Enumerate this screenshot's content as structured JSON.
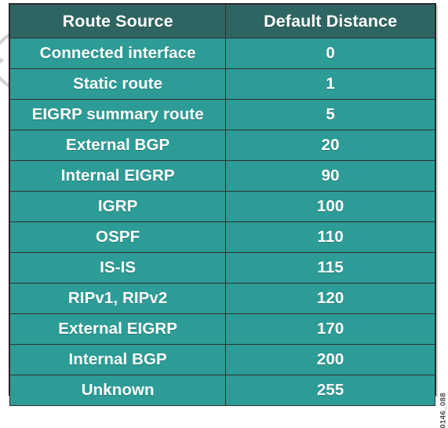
{
  "figure": {
    "id_watermark": "0146_088",
    "decorative_edge_icon": "chevron-artifact"
  },
  "colors": {
    "header_bg": "#2e6562",
    "cell_bg": "#2d9c96",
    "text": "#ffffff",
    "gridline": "#2f2f2f",
    "page_bg": "#ffffff",
    "watermark_text": "#4a4a4a"
  },
  "table": {
    "columns": [
      {
        "key": "route_source",
        "label": "Route Source"
      },
      {
        "key": "default_distance",
        "label": "Default Distance"
      }
    ],
    "rows": [
      {
        "route_source": "Connected interface",
        "default_distance": "0"
      },
      {
        "route_source": "Static route",
        "default_distance": "1"
      },
      {
        "route_source": "EIGRP summary route",
        "default_distance": "5"
      },
      {
        "route_source": "External BGP",
        "default_distance": "20"
      },
      {
        "route_source": "Internal EIGRP",
        "default_distance": "90"
      },
      {
        "route_source": "IGRP",
        "default_distance": "100"
      },
      {
        "route_source": "OSPF",
        "default_distance": "110"
      },
      {
        "route_source": "IS-IS",
        "default_distance": "115"
      },
      {
        "route_source": "RIPv1, RIPv2",
        "default_distance": "120"
      },
      {
        "route_source": "External EIGRP",
        "default_distance": "170"
      },
      {
        "route_source": "Internal BGP",
        "default_distance": "200"
      },
      {
        "route_source": "Unknown",
        "default_distance": "255"
      }
    ]
  },
  "chart_data": {
    "type": "table",
    "title": "",
    "columns": [
      "Route Source",
      "Default Distance"
    ],
    "categories": [
      "Connected interface",
      "Static route",
      "EIGRP summary route",
      "External BGP",
      "Internal EIGRP",
      "IGRP",
      "OSPF",
      "IS-IS",
      "RIPv1, RIPv2",
      "External EIGRP",
      "Internal BGP",
      "Unknown"
    ],
    "values": [
      0,
      1,
      5,
      20,
      90,
      100,
      110,
      115,
      120,
      170,
      200,
      255
    ],
    "xlabel": "Route Source",
    "ylabel": "Default Distance",
    "grid": true,
    "legend": "none"
  }
}
